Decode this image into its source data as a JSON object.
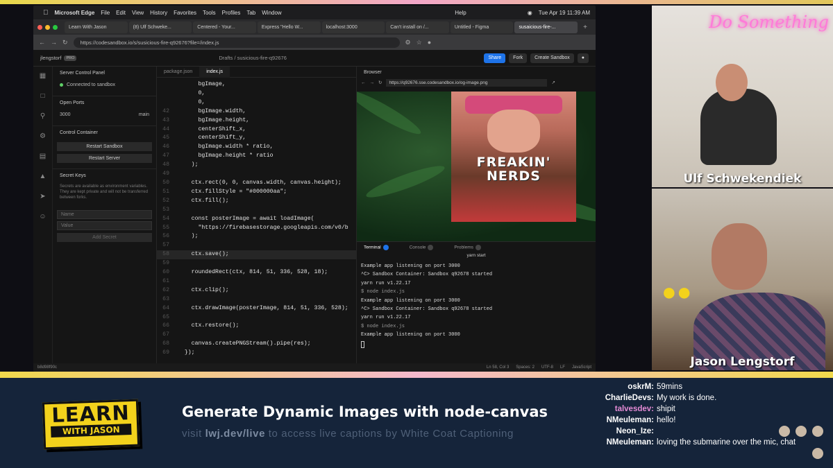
{
  "menubar": {
    "app": "Microsoft Edge",
    "items": [
      "File",
      "Edit",
      "View",
      "History",
      "Favorites",
      "Tools",
      "Profiles",
      "Tab",
      "Window"
    ],
    "help": "Help",
    "clock": "Tue Apr 19  11:39 AM"
  },
  "tabs": [
    "Learn With Jason",
    "(8) Ulf Schweke...",
    "Centered - Your...",
    "Express \"Hello W...",
    "localhost:3000",
    "Can't install on /...",
    "Untitled - Figma",
    "susaicious-fire-..."
  ],
  "address": "https://codesandbox.io/s/susicious-fire-q92676?file=/index.js",
  "csb": {
    "user": "jlengstorf",
    "badge": "PRO",
    "breadcrumb": "Drafts  /  susicious-fire-q92676",
    "share": "Share",
    "fork": "Fork",
    "create": "Create Sandbox"
  },
  "sidebar": {
    "title": "Server Control Panel",
    "connected": "Connected to sandbox",
    "open_ports": "Open Ports",
    "port": "3000",
    "port_branch": "main",
    "control": "Control Container",
    "restart_sandbox": "Restart Sandbox",
    "restart_server": "Restart Server",
    "secret_keys": "Secret Keys",
    "secret_desc": "Secrets are available as environment variables. They are kept private and will not be transferred between forks.",
    "name_ph": "Name",
    "value_ph": "Value",
    "add_secret": "Add Secret"
  },
  "editor": {
    "tabs": [
      "package.json",
      "index.js"
    ],
    "lines": [
      {
        "n": "",
        "t": "      bgImage,"
      },
      {
        "n": "",
        "t": "      0,"
      },
      {
        "n": "",
        "t": "      0,"
      },
      {
        "n": "42",
        "t": "      bgImage.width,"
      },
      {
        "n": "43",
        "t": "      bgImage.height,"
      },
      {
        "n": "44",
        "t": "      centerShift_x,"
      },
      {
        "n": "45",
        "t": "      centerShift_y,"
      },
      {
        "n": "46",
        "t": "      bgImage.width * ratio,"
      },
      {
        "n": "47",
        "t": "      bgImage.height * ratio"
      },
      {
        "n": "48",
        "t": "    );"
      },
      {
        "n": "49",
        "t": ""
      },
      {
        "n": "50",
        "t": "    ctx.rect(0, 0, canvas.width, canvas.height);"
      },
      {
        "n": "51",
        "t": "    ctx.fillStyle = \"#000000aa\";"
      },
      {
        "n": "52",
        "t": "    ctx.fill();"
      },
      {
        "n": "53",
        "t": ""
      },
      {
        "n": "54",
        "t": "    const posterImage = await loadImage("
      },
      {
        "n": "55",
        "t": "      \"https://firebasestorage.googleapis.com/v0/b"
      },
      {
        "n": "56",
        "t": "    );"
      },
      {
        "n": "57",
        "t": ""
      },
      {
        "n": "58",
        "t": "    ctx.save();"
      },
      {
        "n": "59",
        "t": ""
      },
      {
        "n": "60",
        "t": "    roundedRect(ctx, 814, 51, 336, 528, 18);"
      },
      {
        "n": "61",
        "t": ""
      },
      {
        "n": "62",
        "t": "    ctx.clip();"
      },
      {
        "n": "63",
        "t": ""
      },
      {
        "n": "64",
        "t": "    ctx.drawImage(posterImage, 814, 51, 336, 528);"
      },
      {
        "n": "65",
        "t": ""
      },
      {
        "n": "66",
        "t": "    ctx.restore();"
      },
      {
        "n": "67",
        "t": ""
      },
      {
        "n": "68",
        "t": "    canvas.createPNGStream().pipe(res);"
      },
      {
        "n": "69",
        "t": "  });"
      }
    ]
  },
  "browser": {
    "label": "Browser",
    "url": "https://q92676.sse.codesandbox.io/og-image.png",
    "poster_text_1": "FREAKIN'",
    "poster_text_2": "NERDS"
  },
  "terminal": {
    "tabs": [
      "Terminal",
      "Console",
      "Problems"
    ],
    "title": "yarn start",
    "lines": [
      "Example app listening on port 3000",
      "^C> Sandbox Container: Sandbox q92678 started",
      "yarn run v1.22.17",
      "$ node index.js",
      "Example app listening on port 3000",
      "^C> Sandbox Container: Sandbox q92678 started",
      "yarn run v1.22.17",
      "$ node index.js",
      "Example app listening on port 3000"
    ]
  },
  "status": {
    "left": "b8d98f90c",
    "pos": "Ln 58, Col 3",
    "spaces": "Spaces: 2",
    "enc": "UTF-8",
    "eol": "LF",
    "lang": "JavaScript"
  },
  "cams": {
    "neon": "Do Something",
    "name1": "Ulf Schwekendiek",
    "name2": "Jason Lengstorf"
  },
  "bottom": {
    "logo_1": "LEARN",
    "logo_2": "WITH JASON",
    "title": "Generate Dynamic Images with node-canvas",
    "cap_pre": "visit ",
    "cap_link": "lwj.dev/live",
    "cap_post": " to access live captions by White Coat Captioning"
  },
  "chat": [
    {
      "user": "oskrM:",
      "text": "59mins",
      "color": "#ffffff",
      "emotes": 0
    },
    {
      "user": "CharlieDevs:",
      "text": "My work is done.",
      "color": "#ffffff",
      "emotes": 0
    },
    {
      "user": "talvesdev:",
      "text": "shipit",
      "color": "#e58bd6",
      "emotes": 0
    },
    {
      "user": "NMeuleman:",
      "text": "hello!",
      "color": "#ffffff",
      "emotes": 0
    },
    {
      "user": "Neon_Ize:",
      "text": "",
      "color": "#ffffff",
      "emotes": 3
    },
    {
      "user": "NMeuleman:",
      "text": "loving the submarine over the mic, chat",
      "color": "#ffffff",
      "emotes": 0
    },
    {
      "user": "",
      "text": "",
      "color": "#ffffff",
      "emotes": 1
    }
  ]
}
